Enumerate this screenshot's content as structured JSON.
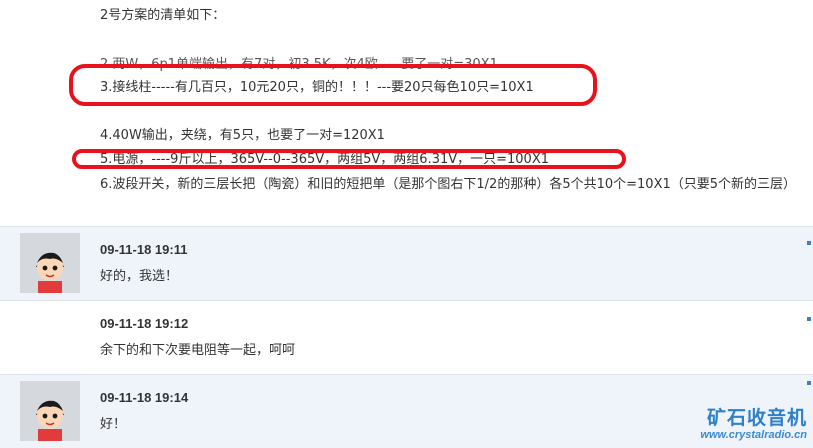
{
  "post": {
    "intro": "2号方案的清单如下：",
    "item2_partial": "2.两W，6p1单端输出，有7对，初3.5K，次4欧-----要了一对=30X1",
    "item3": "3.接线柱-----有几百只，10元20只，铜的！！！---要20只每色10只=10X1",
    "item4": "4.40W输出，夹绕，有5只，也要了一对=120X1",
    "item5": "5.电源，----9斤以上，365V--0--365V，两组5V，两组6.31V，一只=100X1",
    "item6": "6.波段开关，新的三层长把（陶瓷）和旧的短把单（是那个图右下1/2的那种）各5个共10个=10X1（只要5个新的三层）",
    "highlight_color": "#e8121c"
  },
  "replies": [
    {
      "time": "09-11-18 19:11",
      "text": "好的，我选！",
      "has_avatar": true
    },
    {
      "time": "09-11-18 19:12",
      "text": "余下的和下次要电阻等一起，呵呵",
      "has_avatar": false
    },
    {
      "time": "09-11-18 19:14",
      "text": "好！",
      "has_avatar": true
    }
  ],
  "watermark": {
    "title": "矿石收音机",
    "url": "www.crystalradio.cn"
  }
}
